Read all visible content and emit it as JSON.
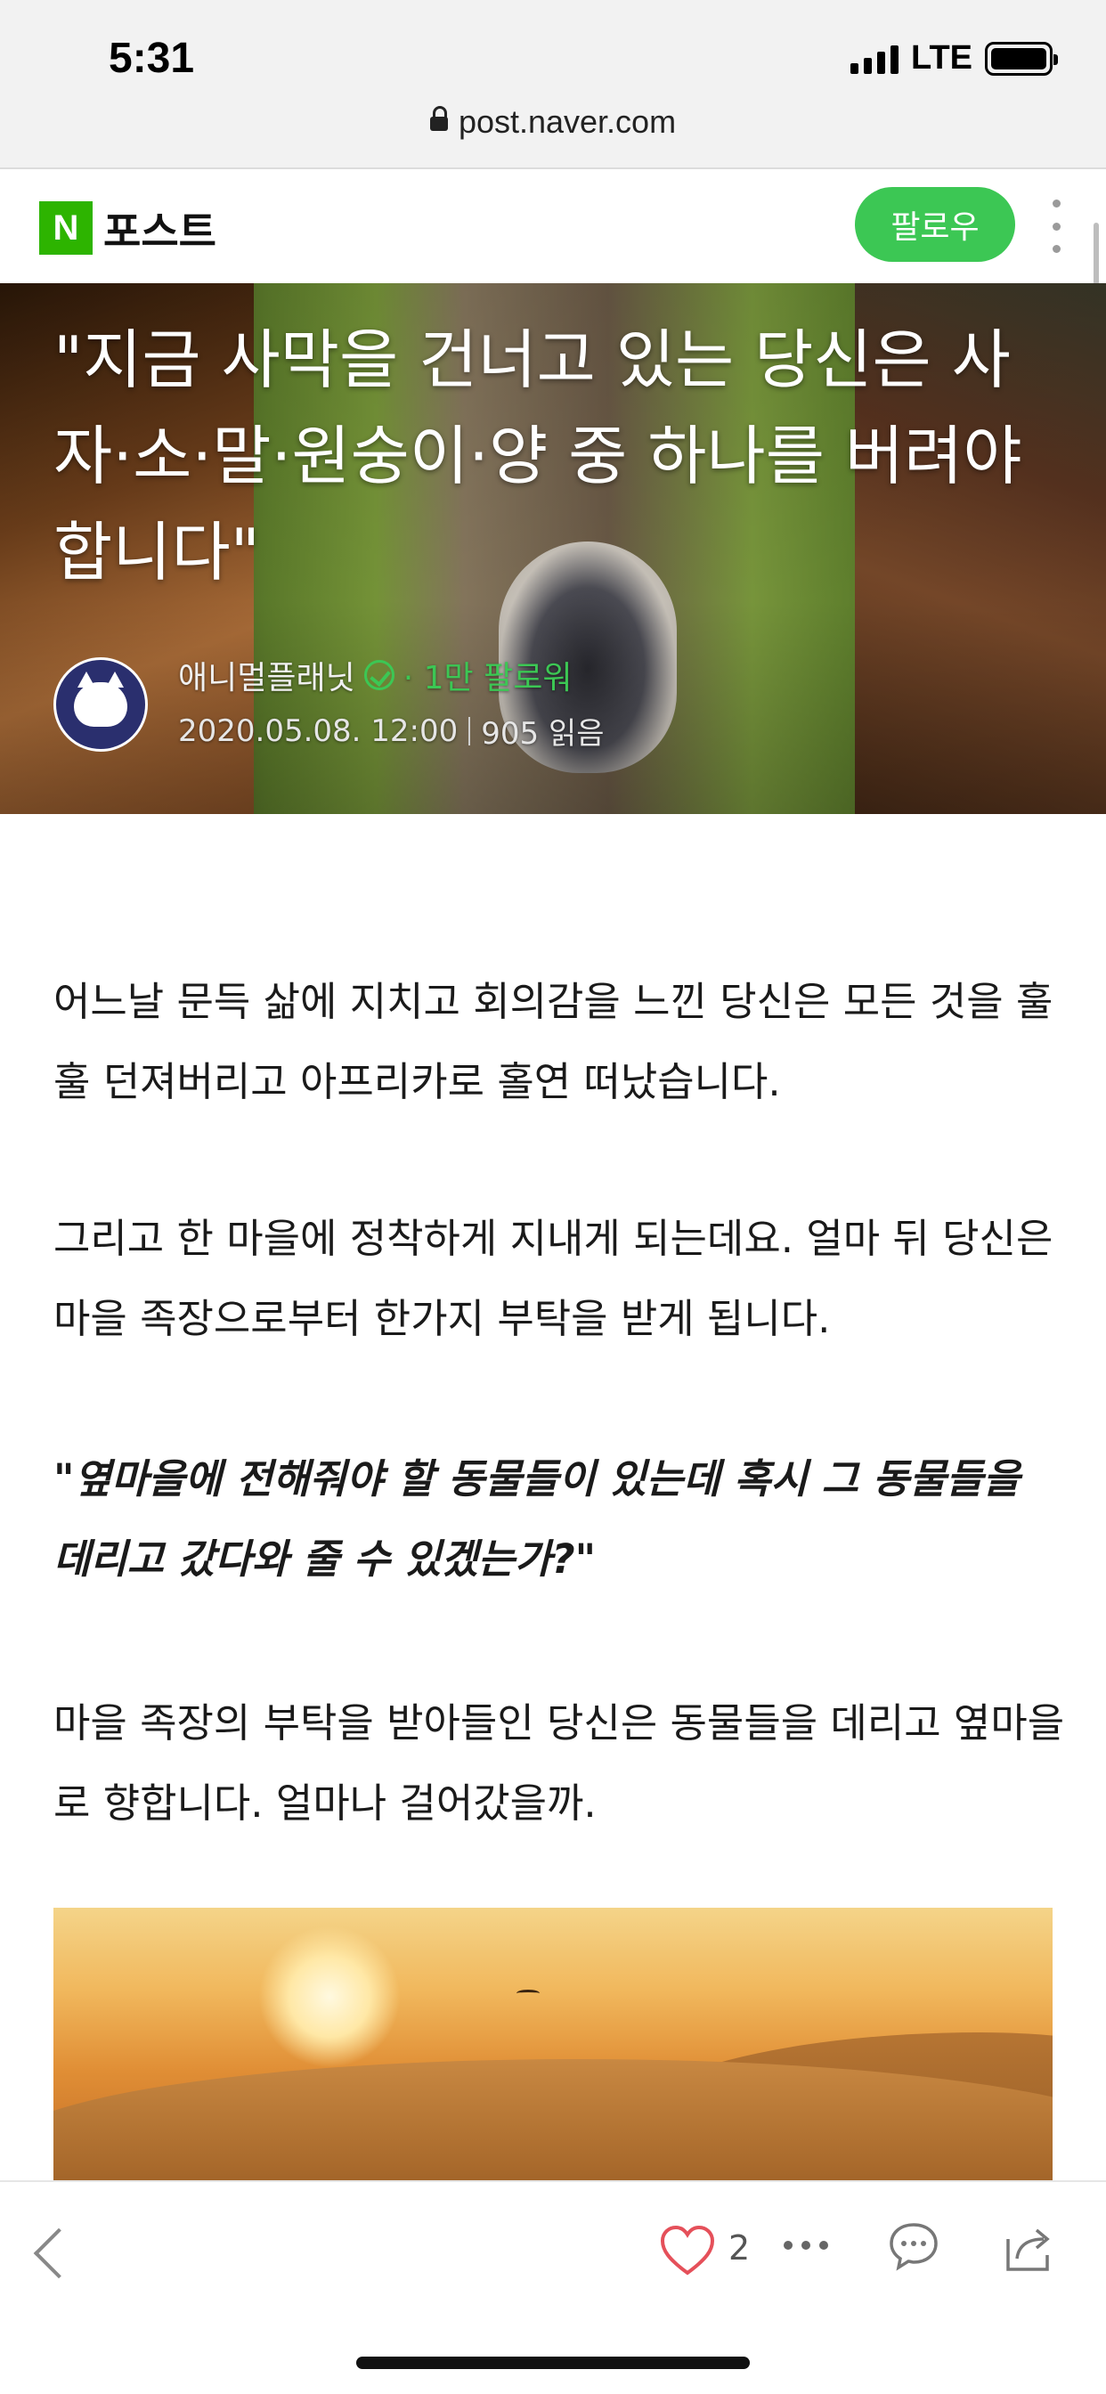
{
  "status_bar": {
    "time": "5:31",
    "network": "LTE"
  },
  "browser": {
    "url": "post.naver.com"
  },
  "header": {
    "logo_letter": "N",
    "brand": "포스트",
    "follow_label": "팔로우"
  },
  "hero": {
    "title": "\"지금 사막을 건너고 있는 당신은 사자·소·말·원숭이·양 중 하나를 버려야 합니다\"",
    "author": "애니멀플래닛",
    "followers": "· 1만 팔로워",
    "date": "2020.05.08. 12:00",
    "reads": "905 읽음"
  },
  "article": {
    "p1": "어느날 문득 삶에 지치고 회의감을 느낀 당신은 모든 것을 훌훌 던져버리고 아프리카로 홀연 떠났습니다.",
    "p2": "그리고 한 마을에 정착하게 지내게 되는데요. 얼마 뒤 당신은 마을 족장으로부터 한가지 부탁을 받게 됩니다.",
    "quote": "\"옆마을에 전해줘야 할 동물들이 있는데 혹시 그 동물들을 데리고 갔다와 줄 수 있겠는가?\"",
    "p3": "마을 족장의 부탁을 받아들인 당신은 동물들을 데리고 옆마을로 향합니다. 얼마나 걸어갔을까."
  },
  "toolbar": {
    "like_count": "2"
  },
  "colors": {
    "accent_green": "#3cc754",
    "naver_green": "#2db400"
  }
}
